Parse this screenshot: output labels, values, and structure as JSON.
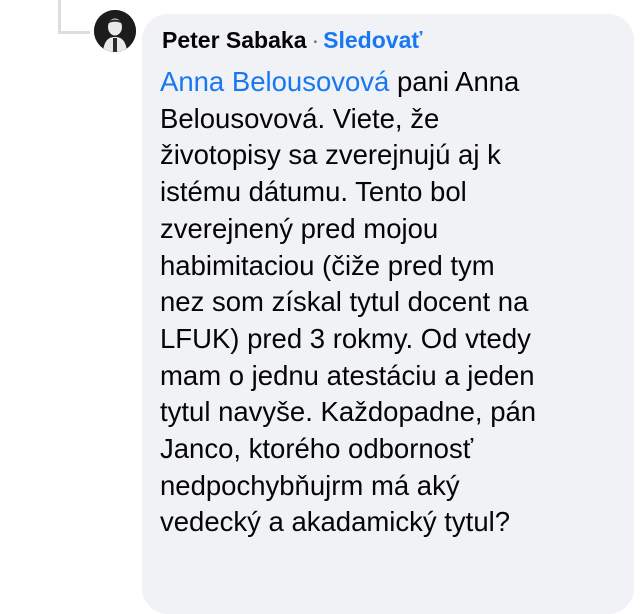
{
  "comment": {
    "author": "Peter Sabaka",
    "separator": "·",
    "follow_label": "Sledovať",
    "mention": "Anna Belousovová",
    "lines": [
      " pani Anna",
      "Belousovová. Viete, že",
      "životopisy sa zverejnujú aj k",
      "istému dátumu. Tento bol",
      "zverejnený pred mojou",
      "habimitaciou (čiže pred tym",
      "nez som získal tytul docent na",
      "LFUK) pred 3 rokmy. Od vtedy",
      "mam o jednu atestáciu a jeden",
      "tytul navyše.  Každopadne, pán",
      "Janco, ktorého odbornosť",
      "nedpochybňujrm má aký",
      "vedecký a akadamický tytul?"
    ]
  },
  "colors": {
    "link": "#1877f2",
    "bubble": "#f0f2f5",
    "text": "#050505"
  },
  "icons": {
    "avatar": "user-avatar-photo"
  }
}
